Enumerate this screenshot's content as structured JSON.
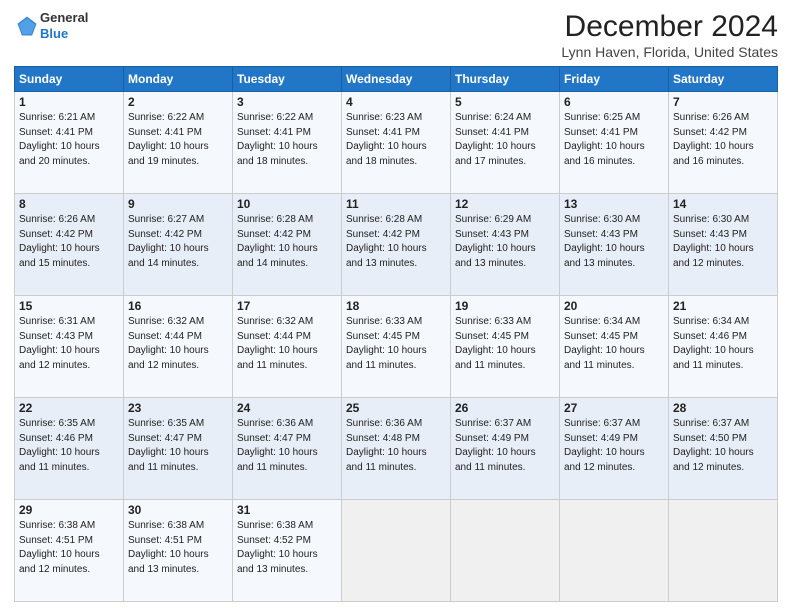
{
  "header": {
    "logo_line1": "General",
    "logo_line2": "Blue",
    "title": "December 2024",
    "subtitle": "Lynn Haven, Florida, United States"
  },
  "weekdays": [
    "Sunday",
    "Monday",
    "Tuesday",
    "Wednesday",
    "Thursday",
    "Friday",
    "Saturday"
  ],
  "weeks": [
    [
      {
        "day": "1",
        "info": "Sunrise: 6:21 AM\nSunset: 4:41 PM\nDaylight: 10 hours\nand 20 minutes."
      },
      {
        "day": "2",
        "info": "Sunrise: 6:22 AM\nSunset: 4:41 PM\nDaylight: 10 hours\nand 19 minutes."
      },
      {
        "day": "3",
        "info": "Sunrise: 6:22 AM\nSunset: 4:41 PM\nDaylight: 10 hours\nand 18 minutes."
      },
      {
        "day": "4",
        "info": "Sunrise: 6:23 AM\nSunset: 4:41 PM\nDaylight: 10 hours\nand 18 minutes."
      },
      {
        "day": "5",
        "info": "Sunrise: 6:24 AM\nSunset: 4:41 PM\nDaylight: 10 hours\nand 17 minutes."
      },
      {
        "day": "6",
        "info": "Sunrise: 6:25 AM\nSunset: 4:41 PM\nDaylight: 10 hours\nand 16 minutes."
      },
      {
        "day": "7",
        "info": "Sunrise: 6:26 AM\nSunset: 4:42 PM\nDaylight: 10 hours\nand 16 minutes."
      }
    ],
    [
      {
        "day": "8",
        "info": "Sunrise: 6:26 AM\nSunset: 4:42 PM\nDaylight: 10 hours\nand 15 minutes."
      },
      {
        "day": "9",
        "info": "Sunrise: 6:27 AM\nSunset: 4:42 PM\nDaylight: 10 hours\nand 14 minutes."
      },
      {
        "day": "10",
        "info": "Sunrise: 6:28 AM\nSunset: 4:42 PM\nDaylight: 10 hours\nand 14 minutes."
      },
      {
        "day": "11",
        "info": "Sunrise: 6:28 AM\nSunset: 4:42 PM\nDaylight: 10 hours\nand 13 minutes."
      },
      {
        "day": "12",
        "info": "Sunrise: 6:29 AM\nSunset: 4:43 PM\nDaylight: 10 hours\nand 13 minutes."
      },
      {
        "day": "13",
        "info": "Sunrise: 6:30 AM\nSunset: 4:43 PM\nDaylight: 10 hours\nand 13 minutes."
      },
      {
        "day": "14",
        "info": "Sunrise: 6:30 AM\nSunset: 4:43 PM\nDaylight: 10 hours\nand 12 minutes."
      }
    ],
    [
      {
        "day": "15",
        "info": "Sunrise: 6:31 AM\nSunset: 4:43 PM\nDaylight: 10 hours\nand 12 minutes."
      },
      {
        "day": "16",
        "info": "Sunrise: 6:32 AM\nSunset: 4:44 PM\nDaylight: 10 hours\nand 12 minutes."
      },
      {
        "day": "17",
        "info": "Sunrise: 6:32 AM\nSunset: 4:44 PM\nDaylight: 10 hours\nand 11 minutes."
      },
      {
        "day": "18",
        "info": "Sunrise: 6:33 AM\nSunset: 4:45 PM\nDaylight: 10 hours\nand 11 minutes."
      },
      {
        "day": "19",
        "info": "Sunrise: 6:33 AM\nSunset: 4:45 PM\nDaylight: 10 hours\nand 11 minutes."
      },
      {
        "day": "20",
        "info": "Sunrise: 6:34 AM\nSunset: 4:45 PM\nDaylight: 10 hours\nand 11 minutes."
      },
      {
        "day": "21",
        "info": "Sunrise: 6:34 AM\nSunset: 4:46 PM\nDaylight: 10 hours\nand 11 minutes."
      }
    ],
    [
      {
        "day": "22",
        "info": "Sunrise: 6:35 AM\nSunset: 4:46 PM\nDaylight: 10 hours\nand 11 minutes."
      },
      {
        "day": "23",
        "info": "Sunrise: 6:35 AM\nSunset: 4:47 PM\nDaylight: 10 hours\nand 11 minutes."
      },
      {
        "day": "24",
        "info": "Sunrise: 6:36 AM\nSunset: 4:47 PM\nDaylight: 10 hours\nand 11 minutes."
      },
      {
        "day": "25",
        "info": "Sunrise: 6:36 AM\nSunset: 4:48 PM\nDaylight: 10 hours\nand 11 minutes."
      },
      {
        "day": "26",
        "info": "Sunrise: 6:37 AM\nSunset: 4:49 PM\nDaylight: 10 hours\nand 11 minutes."
      },
      {
        "day": "27",
        "info": "Sunrise: 6:37 AM\nSunset: 4:49 PM\nDaylight: 10 hours\nand 12 minutes."
      },
      {
        "day": "28",
        "info": "Sunrise: 6:37 AM\nSunset: 4:50 PM\nDaylight: 10 hours\nand 12 minutes."
      }
    ],
    [
      {
        "day": "29",
        "info": "Sunrise: 6:38 AM\nSunset: 4:51 PM\nDaylight: 10 hours\nand 12 minutes."
      },
      {
        "day": "30",
        "info": "Sunrise: 6:38 AM\nSunset: 4:51 PM\nDaylight: 10 hours\nand 13 minutes."
      },
      {
        "day": "31",
        "info": "Sunrise: 6:38 AM\nSunset: 4:52 PM\nDaylight: 10 hours\nand 13 minutes."
      },
      {
        "day": "",
        "info": ""
      },
      {
        "day": "",
        "info": ""
      },
      {
        "day": "",
        "info": ""
      },
      {
        "day": "",
        "info": ""
      }
    ]
  ]
}
